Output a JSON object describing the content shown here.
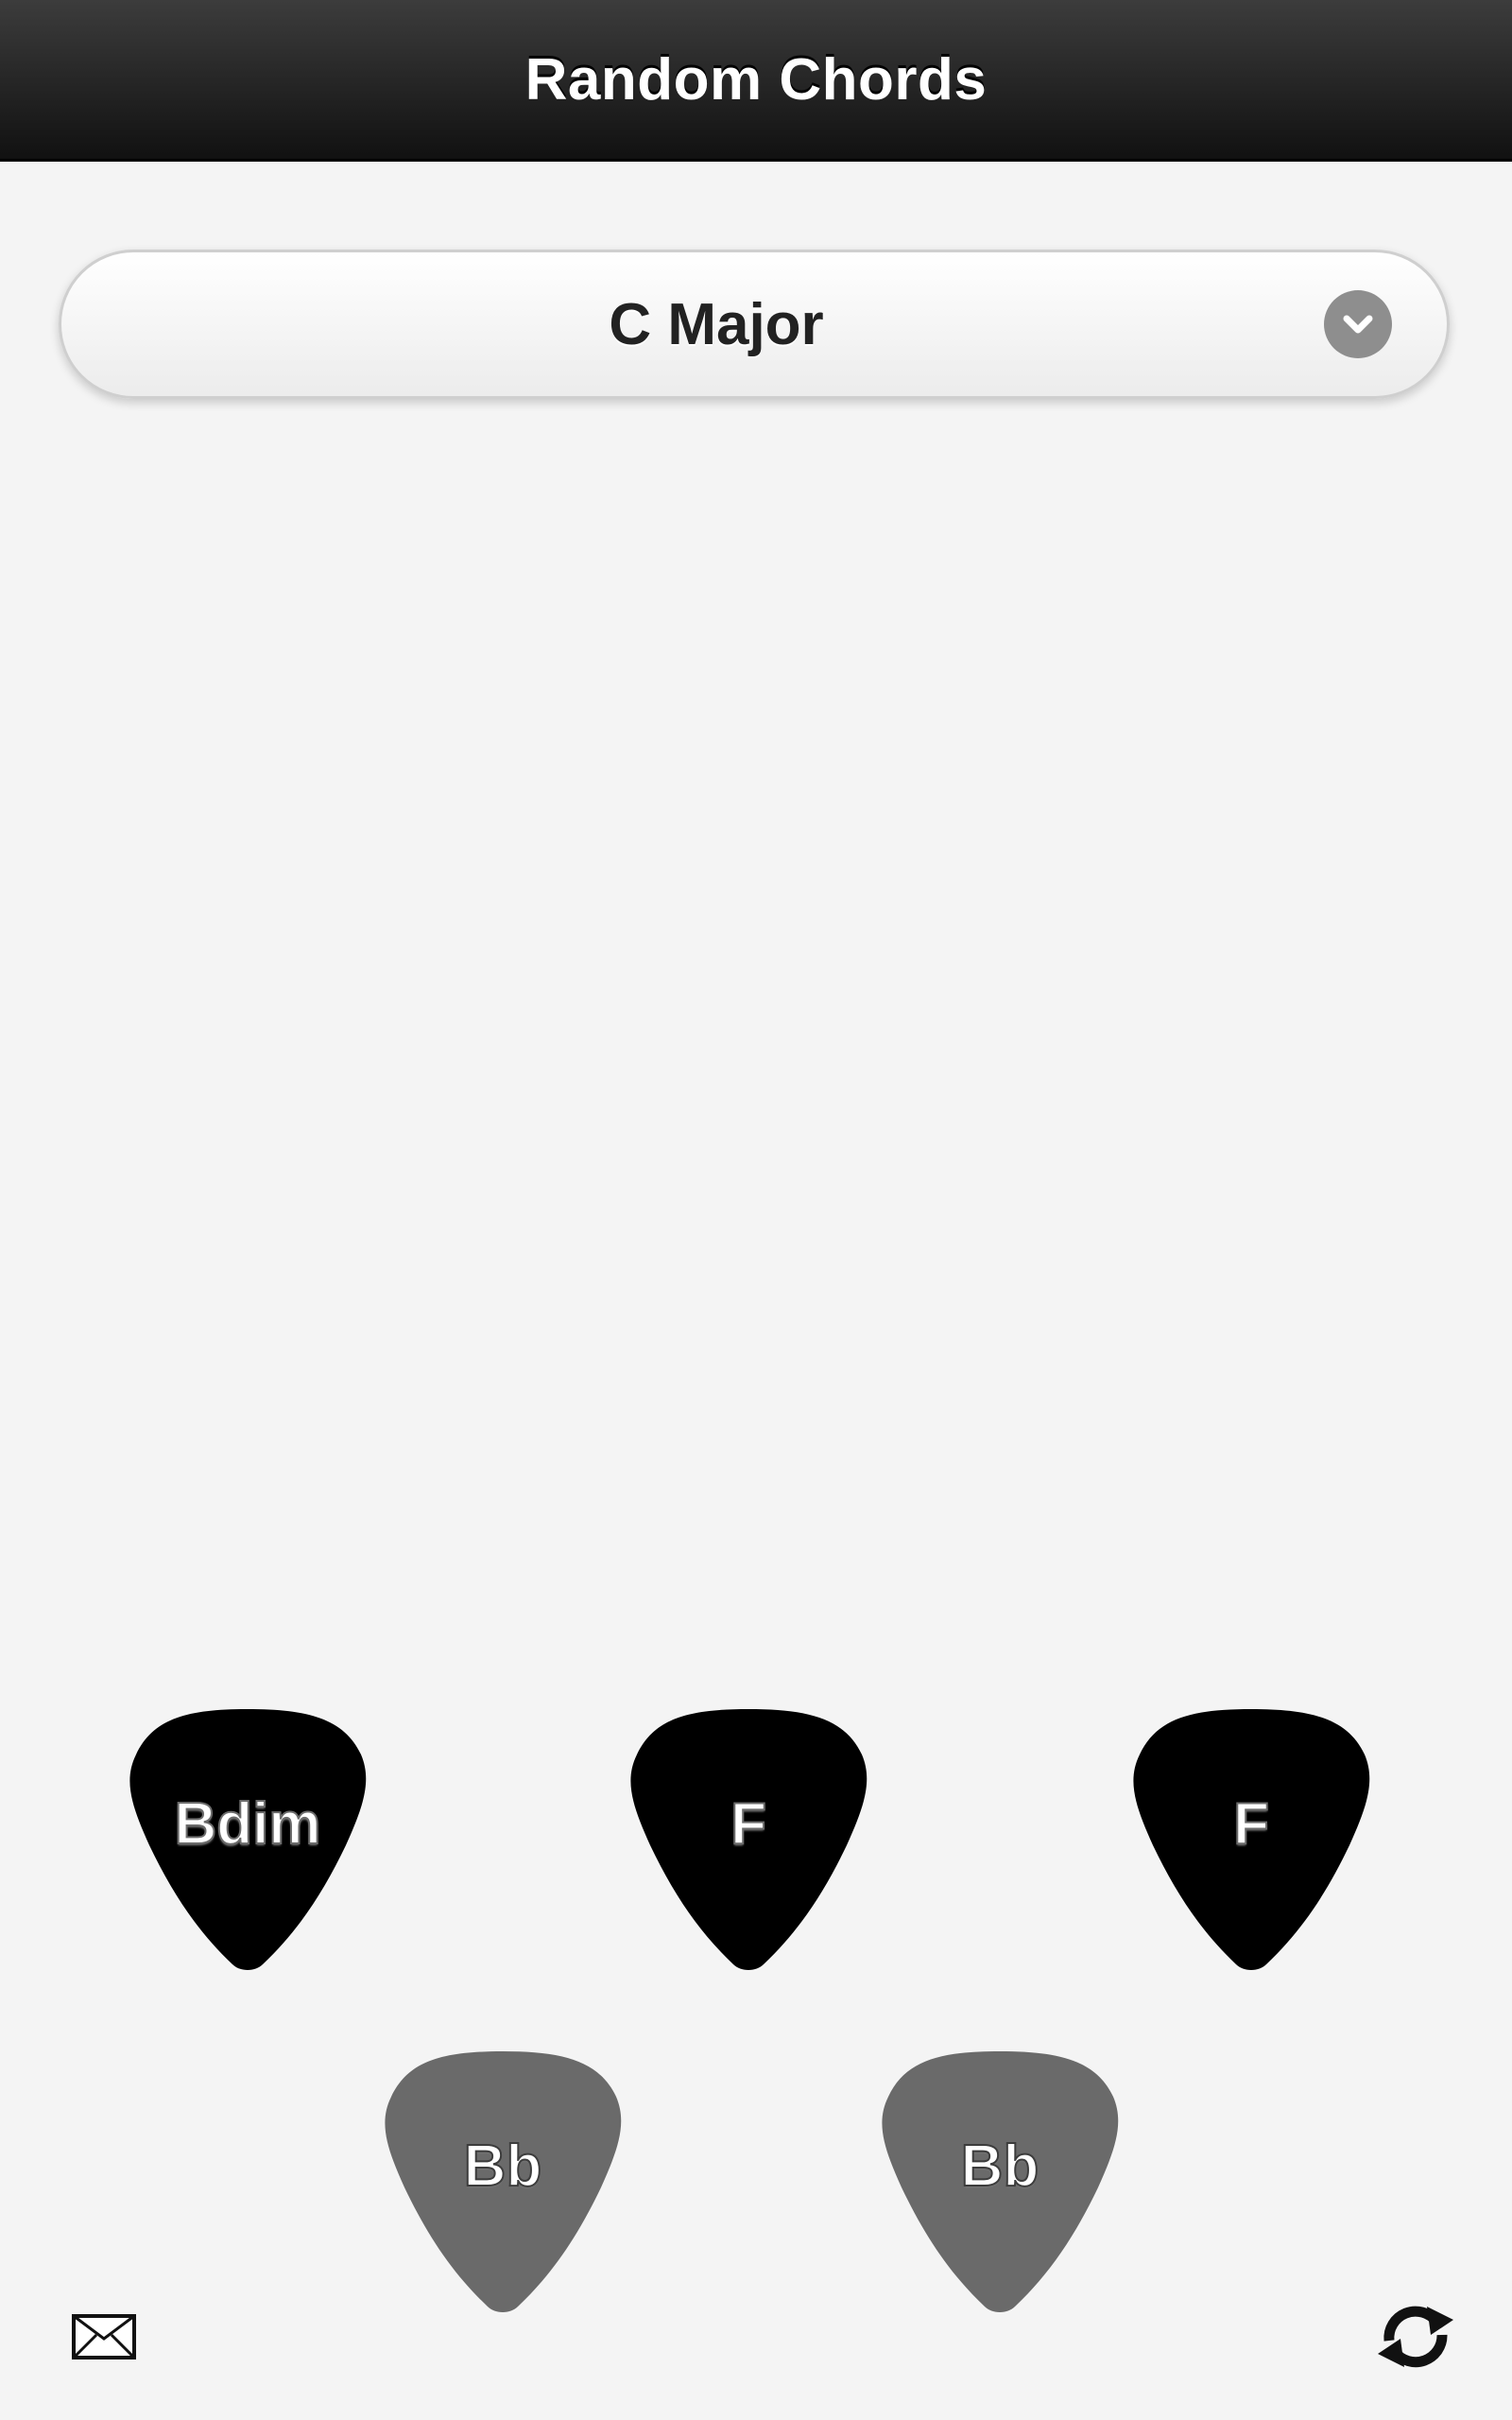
{
  "header": {
    "title": "Random Chords"
  },
  "key_selector": {
    "selected": "C Major",
    "icon": "chevron-down-icon"
  },
  "chord_picks": [
    {
      "label": "Bdim",
      "color": "#000000"
    },
    {
      "label": "F",
      "color": "#000000"
    },
    {
      "label": "F",
      "color": "#000000"
    },
    {
      "label": "Bb",
      "color": "#6a6a6a"
    },
    {
      "label": "Bb",
      "color": "#6a6a6a"
    }
  ],
  "footer": {
    "mail_icon": "mail-icon",
    "refresh_icon": "refresh-icon"
  }
}
